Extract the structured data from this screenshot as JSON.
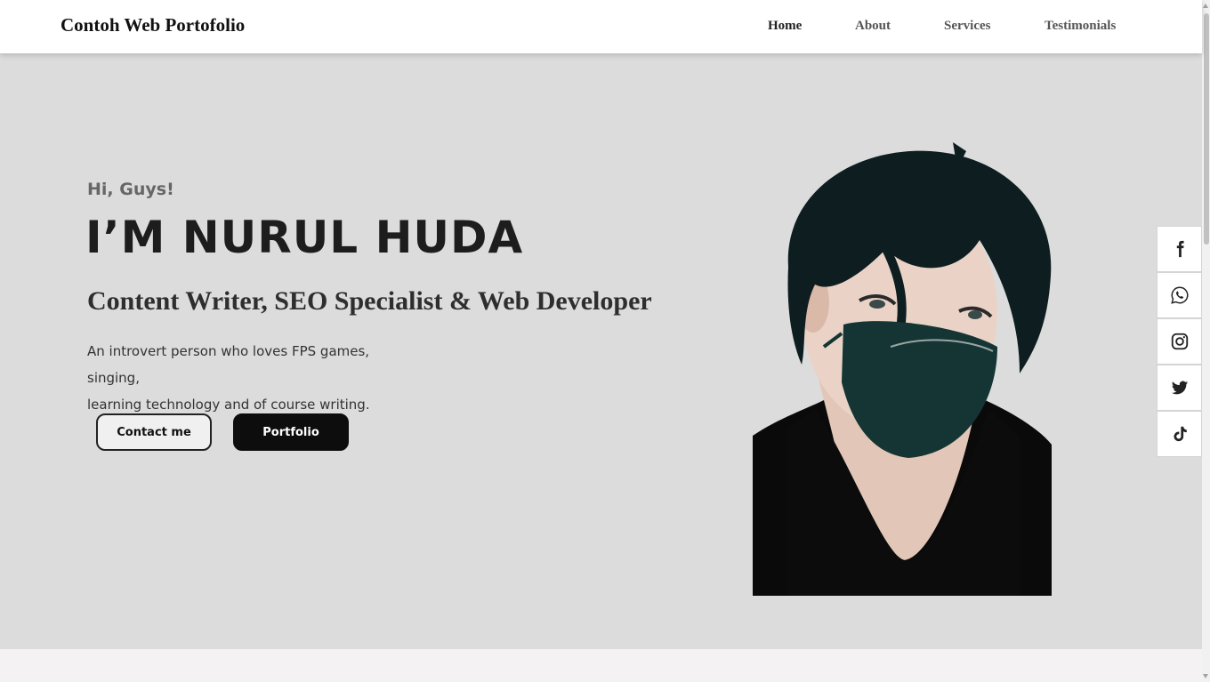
{
  "header": {
    "brand": "Contoh Web Portofolio",
    "nav": [
      {
        "label": "Home",
        "active": true
      },
      {
        "label": "About",
        "active": false
      },
      {
        "label": "Services",
        "active": false
      },
      {
        "label": "Testimonials",
        "active": false
      }
    ]
  },
  "hero": {
    "greeting": "Hi, Guys!",
    "name": "I’M NURUL HUDA",
    "role": "Content Writer, SEO Specialist & Web Developer",
    "bio_line1": "An introvert person who loves FPS games, singing,",
    "bio_line2": "learning technology and of course writing.",
    "contact_button": "Contact me",
    "portfolio_button": "Portfolio"
  },
  "social": [
    {
      "icon": "facebook-icon"
    },
    {
      "icon": "whatsapp-icon"
    },
    {
      "icon": "instagram-icon"
    },
    {
      "icon": "twitter-icon"
    },
    {
      "icon": "tiktok-icon"
    }
  ],
  "colors": {
    "hero_bg": "#dcdcdc",
    "header_bg": "#ffffff",
    "primary_button": "#0d0d0d",
    "text_dark": "#1d1d1d"
  }
}
